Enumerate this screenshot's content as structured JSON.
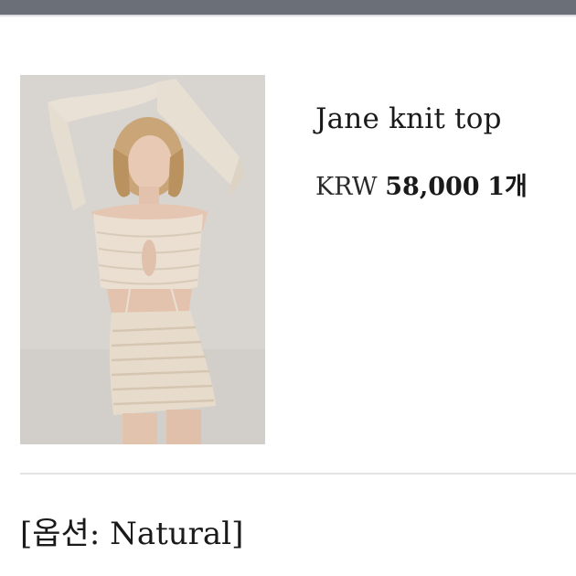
{
  "product": {
    "title": "Jane knit top",
    "price": {
      "currency": "KRW",
      "amount": "58,000",
      "quantity": "1개"
    },
    "option_text": "[옵션: Natural]",
    "image": {
      "subject": "model-wearing-knit-top-and-skirt",
      "background_color": "#d6d2ce",
      "garment_color": "#e6dccd"
    }
  },
  "colors": {
    "top_bar": "#6b6f78",
    "divider": "#e3e3e3",
    "text": "#1a1a1a"
  }
}
